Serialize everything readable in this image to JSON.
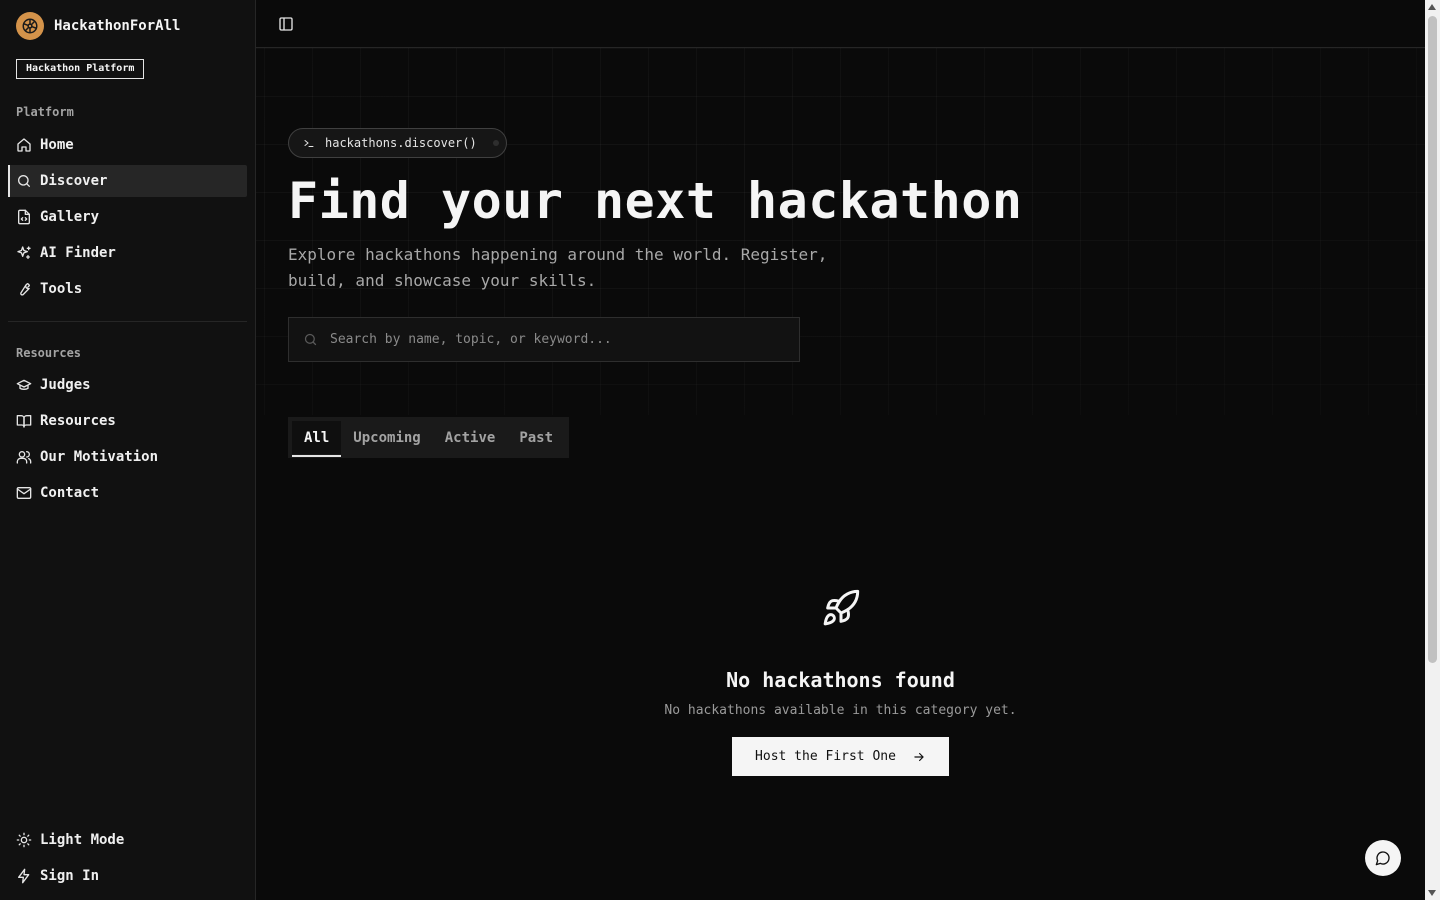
{
  "brand": {
    "name": "HackathonForAll",
    "badge": "Hackathon Platform",
    "logo_color": "#d4934a"
  },
  "sidebar": {
    "platform_label": "Platform",
    "platform_items": [
      {
        "label": "Home",
        "icon": "home-icon"
      },
      {
        "label": "Discover",
        "icon": "search-icon",
        "active": true
      },
      {
        "label": "Gallery",
        "icon": "file-code-icon"
      },
      {
        "label": "AI Finder",
        "icon": "sparkles-icon"
      },
      {
        "label": "Tools",
        "icon": "wrench-icon"
      }
    ],
    "resources_label": "Resources",
    "resource_items": [
      {
        "label": "Judges",
        "icon": "graduation-cap-icon"
      },
      {
        "label": "Resources",
        "icon": "book-open-icon"
      },
      {
        "label": "Our Motivation",
        "icon": "users-icon"
      },
      {
        "label": "Contact",
        "icon": "mail-icon"
      }
    ],
    "footer_items": [
      {
        "label": "Light Mode",
        "icon": "sun-icon"
      },
      {
        "label": "Sign In",
        "icon": "zap-icon"
      }
    ]
  },
  "hero": {
    "command": "hackathons.discover()",
    "title": "Find your next hackathon",
    "subtitle": "Explore hackathons happening around the world. Register, build, and showcase your skills.",
    "search_placeholder": "Search by name, topic, or keyword..."
  },
  "tabs": [
    {
      "label": "All",
      "active": true
    },
    {
      "label": "Upcoming"
    },
    {
      "label": "Active"
    },
    {
      "label": "Past"
    }
  ],
  "empty_state": {
    "title": "No hackathons found",
    "description": "No hackathons available in this category yet.",
    "cta": "Host the First One"
  }
}
